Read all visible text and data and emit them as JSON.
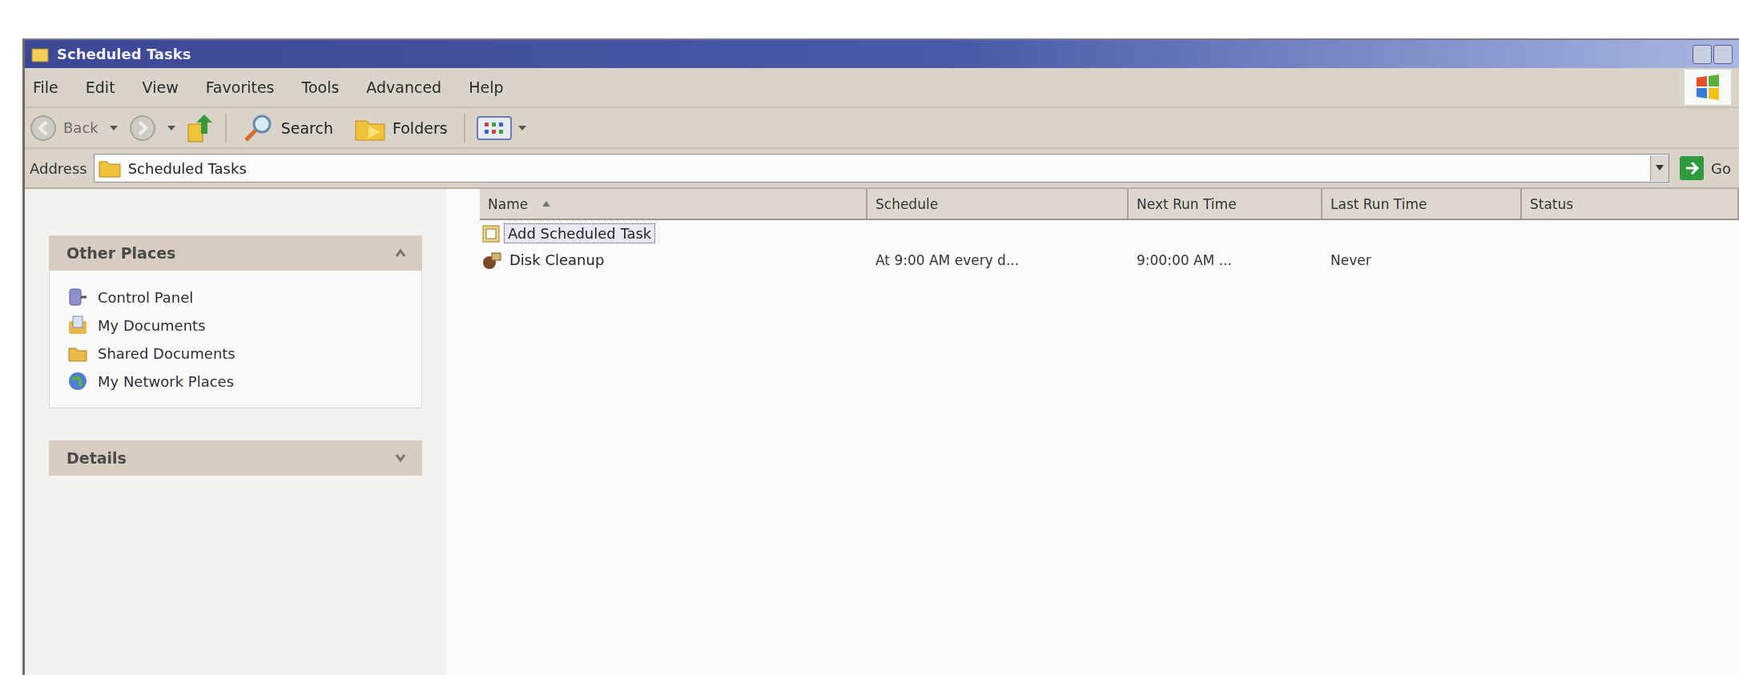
{
  "window": {
    "title": "Scheduled Tasks"
  },
  "menu": [
    {
      "label": "File"
    },
    {
      "label": "Edit"
    },
    {
      "label": "View"
    },
    {
      "label": "Favorites"
    },
    {
      "label": "Tools"
    },
    {
      "label": "Advanced"
    },
    {
      "label": "Help"
    }
  ],
  "toolbar": {
    "back": {
      "label": "Back",
      "disabled": true
    },
    "buttons": [
      {
        "kind": "search",
        "label": "Search"
      },
      {
        "kind": "folders",
        "label": "Folders"
      }
    ]
  },
  "address": {
    "label": "Address",
    "value": "Scheduled Tasks",
    "go": "Go"
  },
  "sidebar": {
    "panels": [
      {
        "title": "Other Places",
        "expanded": true,
        "items": [
          {
            "kind": "control-panel",
            "label": "Control Panel"
          },
          {
            "kind": "documents",
            "label": "My Documents"
          },
          {
            "kind": "folder",
            "label": "Shared Documents"
          },
          {
            "kind": "network",
            "label": "My Network Places"
          }
        ]
      },
      {
        "title": "Details",
        "expanded": false
      }
    ]
  },
  "table": {
    "columns": [
      {
        "label": "Name",
        "sorted": true
      },
      {
        "label": "Schedule",
        "sorted": false
      },
      {
        "label": "Next Run Time",
        "sorted": false
      },
      {
        "label": "Last Run Time",
        "sorted": false
      },
      {
        "label": "Status",
        "sorted": false
      }
    ],
    "rows": [
      {
        "kind": "wizard",
        "name": "Add Scheduled Task",
        "selected": true
      },
      {
        "kind": "task",
        "name": "Disk Cleanup",
        "selected": false,
        "schedule": "At 9:00 AM every d...",
        "next_run": "9:00:00 AM ...",
        "last_run": "Never"
      }
    ]
  }
}
